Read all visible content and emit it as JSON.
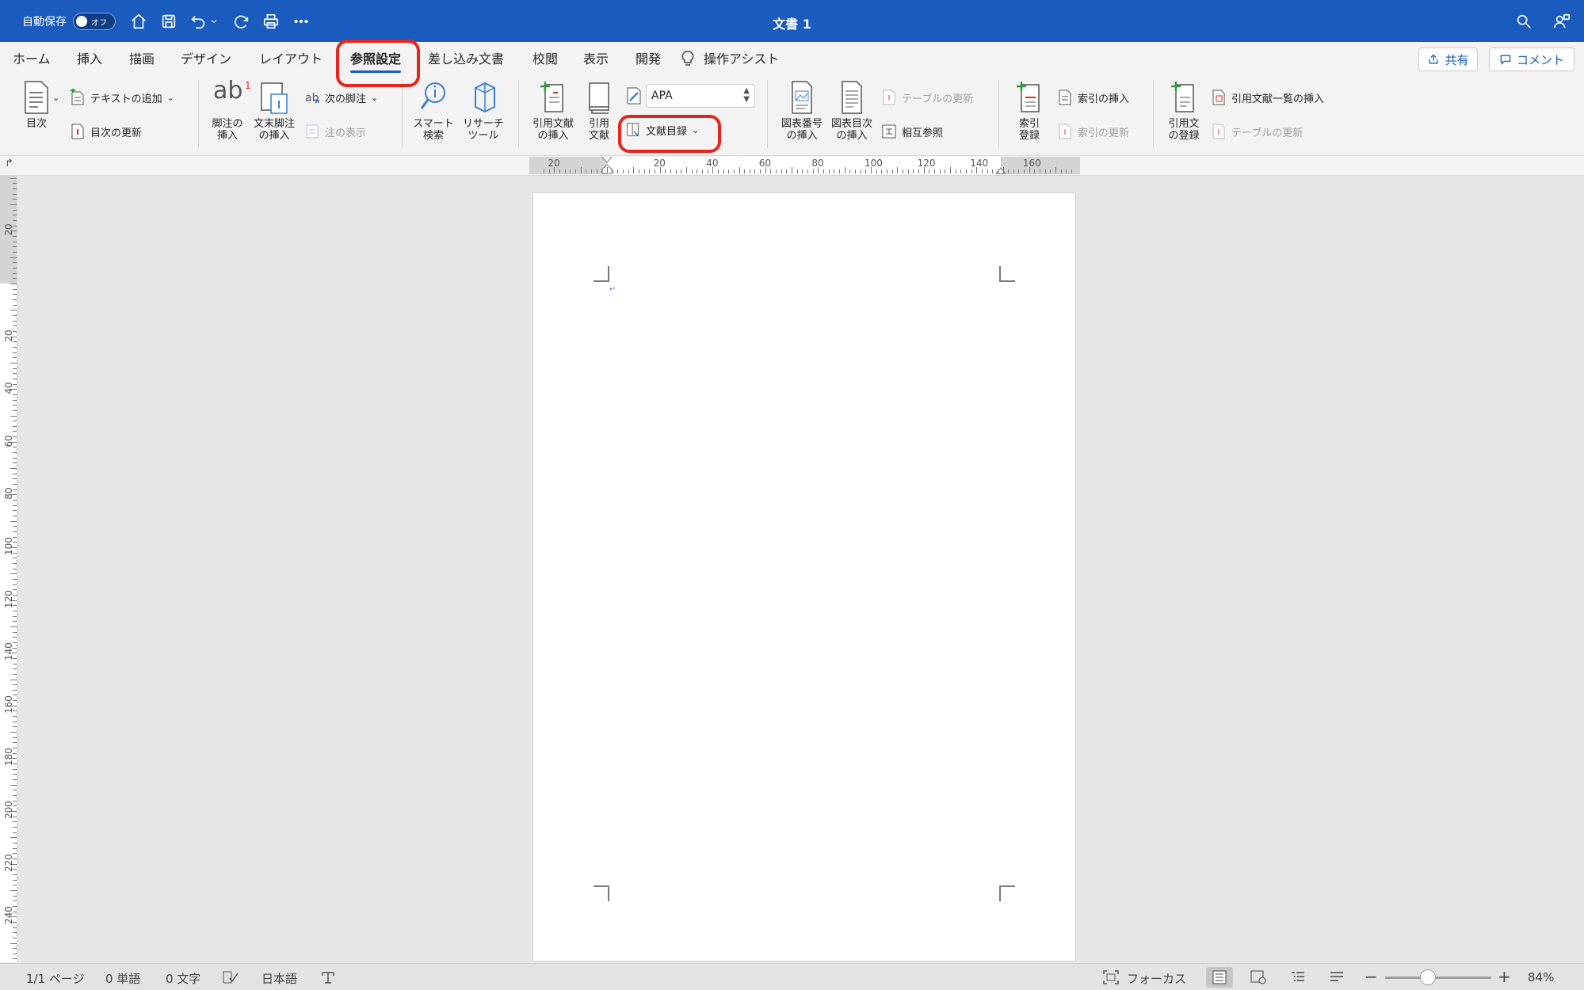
{
  "titlebar": {
    "autosave_label": "自動保存",
    "autosave_state": "オフ",
    "doc_title": "文書 1",
    "icons": [
      "home-icon",
      "save-icon",
      "undo-icon",
      "redo-icon",
      "print-icon",
      "more-icon",
      "search-icon",
      "account-icon"
    ]
  },
  "tabs": {
    "home": "ホーム",
    "insert": "挿入",
    "draw": "描画",
    "design": "デザイン",
    "layout": "レイアウト",
    "references": "参照設定",
    "mailings": "差し込み文書",
    "review": "校閲",
    "view": "表示",
    "developer": "開発",
    "tellme": "操作アシスト",
    "share": "共有",
    "comment": "コメント"
  },
  "ribbon": {
    "toc": "目次",
    "add_text": "テキストの追加",
    "update_toc": "目次の更新",
    "insert_footnote": "脚注の\n挿入",
    "insert_endnote": "文末脚注\nの挿入",
    "next_footnote": "次の脚注",
    "show_notes": "注の表示",
    "smart_lookup": "スマート\n検索",
    "researcher": "リサーチ\nツール",
    "insert_citation": "引用文献\nの挿入",
    "citations": "引用\n文献",
    "style_value": "APA",
    "bibliography": "文献目録",
    "insert_caption": "図表番号\nの挿入",
    "insert_table_of_figures": "図表目次\nの挿入",
    "update_table": "テーブルの更新",
    "cross_reference": "相互参照",
    "mark_entry": "索引\n登録",
    "insert_index": "索引の挿入",
    "update_index": "索引の更新",
    "mark_citation": "引用文\nの登録",
    "insert_toa": "引用文献一覧の挿入",
    "update_toa": "テーブルの更新",
    "footnote_glyph": "ab",
    "footnote_sup": "1"
  },
  "ruler": {
    "h_labels": [
      "20",
      "20",
      "40",
      "60",
      "80",
      "100",
      "120",
      "140",
      "160"
    ],
    "v_labels": [
      "20",
      "20",
      "40",
      "60",
      "80",
      "100",
      "120",
      "140",
      "160",
      "180",
      "200",
      "220",
      "240"
    ]
  },
  "statusbar": {
    "page": "1/1 ページ",
    "words": "0 単語",
    "chars": "0 文字",
    "language": "日本語",
    "focus": "フォーカス",
    "zoom": "84%",
    "zoom_level": 0.84
  },
  "colors": {
    "accent": "#1a5bbe",
    "highlight": "#e8251d"
  }
}
